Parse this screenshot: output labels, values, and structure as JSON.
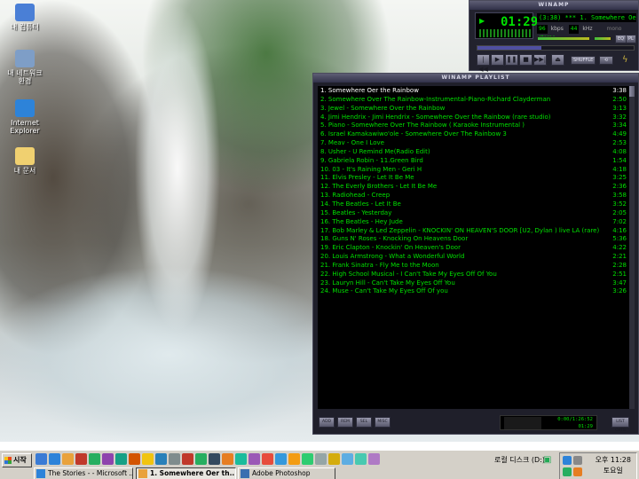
{
  "desktop": {
    "icons": [
      {
        "label": "내 컴퓨터",
        "icon": "my-computer-icon",
        "color": "#4a7fd6"
      },
      {
        "label": "내 네트워크 환경",
        "icon": "network-icon",
        "color": "#7e9ec7"
      },
      {
        "label": "Internet Explorer",
        "icon": "internet-explorer-icon",
        "color": "#2d83d9"
      },
      {
        "label": "내 문서",
        "icon": "my-documents-icon",
        "color": "#f0d070"
      }
    ]
  },
  "winamp": {
    "title": "WINAMP",
    "time": "01:29",
    "song": "(3:38) *** 1. Somewhere Oer th",
    "kbps": "96",
    "kbps_label": "kbps",
    "khz": "44",
    "khz_label": "kHz",
    "mono": "mono",
    "stereo": "stereo",
    "shuffle_label": "SHUFFLE",
    "seek_progress": 0.41,
    "eq_label": "EQ",
    "pl_label": "PL",
    "buttons": [
      "|◀◀",
      "▶",
      "❚❚",
      "■",
      "▶▶|",
      "⏏"
    ]
  },
  "playlist": {
    "title": "WINAMP PLAYLIST",
    "items": [
      {
        "title": "1. Somewhere Oer the Rainbow",
        "duration": "3:38",
        "current": true
      },
      {
        "title": "2. Somewhere Over The Rainbow-Instrumental-Piano-Richard Clayderman",
        "duration": "2:50"
      },
      {
        "title": "3. Jewel - Somewhere Over the Rainbow",
        "duration": "3:13"
      },
      {
        "title": "4. Jimi Hendrix - Jimi Hendrix - Somewhere Over the Rainbow (rare studio)",
        "duration": "3:32"
      },
      {
        "title": "5. Piano - Somewhere Over The Rainbow ( Karaoke Instrumental )",
        "duration": "3:34"
      },
      {
        "title": "6. Israel Kamakawiwo'ole - Somewhere Over The Rainbow 3",
        "duration": "4:49"
      },
      {
        "title": "7. Meav - One I Love",
        "duration": "2:53"
      },
      {
        "title": "8. Usher - U Remind Me(Radio Edit)",
        "duration": "4:08"
      },
      {
        "title": "9. Gabriela Robin - 11.Green Bird",
        "duration": "1:54"
      },
      {
        "title": "10. 03 - It's Raining Men - Geri H",
        "duration": "4:18"
      },
      {
        "title": "11. Elvis Presley - Let It Be Me",
        "duration": "3:25"
      },
      {
        "title": "12. The Everly Brothers - Let It Be Me",
        "duration": "2:36"
      },
      {
        "title": "13. Radiohead - Creep",
        "duration": "3:58"
      },
      {
        "title": "14. The Beatles - Let It Be",
        "duration": "3:52"
      },
      {
        "title": "15. Beatles - Yesterday",
        "duration": "2:05"
      },
      {
        "title": "16. The Beatles - Hey Jude",
        "duration": "7:02"
      },
      {
        "title": "17. Bob Marley & Led Zeppelin - KNOCKIN' ON HEAVEN'S DOOR [U2, Dylan ) live LA (rare)",
        "duration": "4:16"
      },
      {
        "title": "18. Guns N' Roses - Knocking On Heavens Door",
        "duration": "5:36"
      },
      {
        "title": "19. Eric Clapton - Knockin' On Heaven's Door",
        "duration": "4:22"
      },
      {
        "title": "20. Louis Armstrong - What a Wonderful World",
        "duration": "2:21"
      },
      {
        "title": "21. Frank Sinatra - Fly Me to the Moon",
        "duration": "2:28"
      },
      {
        "title": "22. High School Musical - I Can't Take My Eyes Off Of You",
        "duration": "2:51"
      },
      {
        "title": "23. Lauryn Hill - Can't Take My Eyes Off You",
        "duration": "3:47"
      },
      {
        "title": "24. Muse - Can't Take My Eyes Off Of you",
        "duration": "3:26"
      }
    ],
    "buttons": {
      "add": "ADD",
      "rem": "REM",
      "sel": "SEL",
      "misc": "MISC",
      "list": "LIST OPTS"
    },
    "total_time": "0:00/1:26:52",
    "mini_time": "01:29"
  },
  "taskbar": {
    "start_label": "시작",
    "quicklaunch_colors": [
      "#3a7bd5",
      "#2d83d9",
      "#e9a23b",
      "#c0392b",
      "#27ae60",
      "#8e44ad",
      "#16a085",
      "#d35400",
      "#f1c40f",
      "#2980b9",
      "#7f8c8d",
      "#c0392b",
      "#27ae60",
      "#34495e",
      "#e67e22",
      "#1abc9c",
      "#9b59b6",
      "#e74c3c",
      "#3498db",
      "#f39c12",
      "#2ecc71",
      "#95a5a6",
      "#d4ac0d",
      "#5dade2",
      "#48c9b0",
      "#af7ac5"
    ],
    "tasks": [
      {
        "label": "The Stories - - Microsoft ...",
        "color": "#2d83d9",
        "active": false
      },
      {
        "label": "1. Somewhere Oer th...",
        "color": "#e9a23b",
        "active": true
      },
      {
        "label": "Adobe Photoshop",
        "color": "#3a6fb0",
        "active": false
      }
    ],
    "address_label": "로컬 디스크 (D:)",
    "clock_time": "오후 11:28",
    "clock_day": "토요일"
  }
}
